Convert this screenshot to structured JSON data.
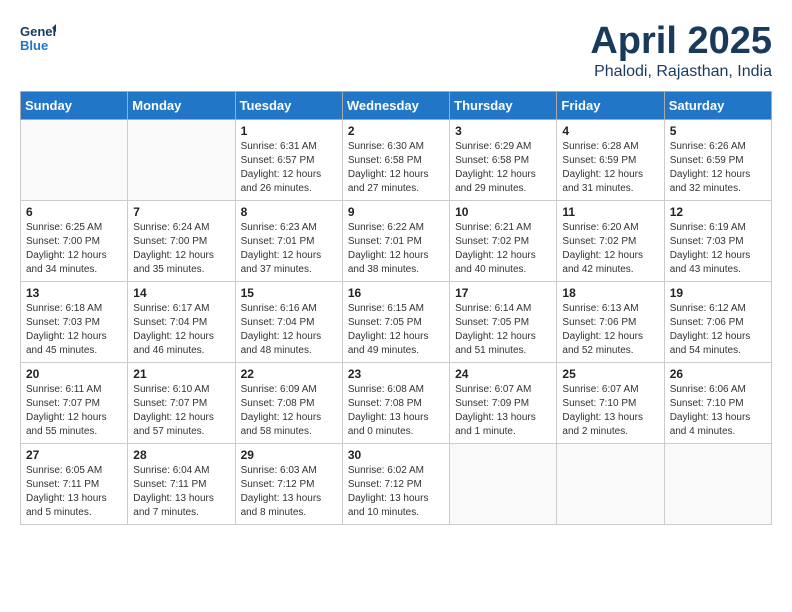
{
  "header": {
    "logo_general": "General",
    "logo_blue": "Blue",
    "month": "April 2025",
    "location": "Phalodi, Rajasthan, India"
  },
  "days_of_week": [
    "Sunday",
    "Monday",
    "Tuesday",
    "Wednesday",
    "Thursday",
    "Friday",
    "Saturday"
  ],
  "weeks": [
    [
      {
        "num": "",
        "info": ""
      },
      {
        "num": "",
        "info": ""
      },
      {
        "num": "1",
        "info": "Sunrise: 6:31 AM\nSunset: 6:57 PM\nDaylight: 12 hours\nand 26 minutes."
      },
      {
        "num": "2",
        "info": "Sunrise: 6:30 AM\nSunset: 6:58 PM\nDaylight: 12 hours\nand 27 minutes."
      },
      {
        "num": "3",
        "info": "Sunrise: 6:29 AM\nSunset: 6:58 PM\nDaylight: 12 hours\nand 29 minutes."
      },
      {
        "num": "4",
        "info": "Sunrise: 6:28 AM\nSunset: 6:59 PM\nDaylight: 12 hours\nand 31 minutes."
      },
      {
        "num": "5",
        "info": "Sunrise: 6:26 AM\nSunset: 6:59 PM\nDaylight: 12 hours\nand 32 minutes."
      }
    ],
    [
      {
        "num": "6",
        "info": "Sunrise: 6:25 AM\nSunset: 7:00 PM\nDaylight: 12 hours\nand 34 minutes."
      },
      {
        "num": "7",
        "info": "Sunrise: 6:24 AM\nSunset: 7:00 PM\nDaylight: 12 hours\nand 35 minutes."
      },
      {
        "num": "8",
        "info": "Sunrise: 6:23 AM\nSunset: 7:01 PM\nDaylight: 12 hours\nand 37 minutes."
      },
      {
        "num": "9",
        "info": "Sunrise: 6:22 AM\nSunset: 7:01 PM\nDaylight: 12 hours\nand 38 minutes."
      },
      {
        "num": "10",
        "info": "Sunrise: 6:21 AM\nSunset: 7:02 PM\nDaylight: 12 hours\nand 40 minutes."
      },
      {
        "num": "11",
        "info": "Sunrise: 6:20 AM\nSunset: 7:02 PM\nDaylight: 12 hours\nand 42 minutes."
      },
      {
        "num": "12",
        "info": "Sunrise: 6:19 AM\nSunset: 7:03 PM\nDaylight: 12 hours\nand 43 minutes."
      }
    ],
    [
      {
        "num": "13",
        "info": "Sunrise: 6:18 AM\nSunset: 7:03 PM\nDaylight: 12 hours\nand 45 minutes."
      },
      {
        "num": "14",
        "info": "Sunrise: 6:17 AM\nSunset: 7:04 PM\nDaylight: 12 hours\nand 46 minutes."
      },
      {
        "num": "15",
        "info": "Sunrise: 6:16 AM\nSunset: 7:04 PM\nDaylight: 12 hours\nand 48 minutes."
      },
      {
        "num": "16",
        "info": "Sunrise: 6:15 AM\nSunset: 7:05 PM\nDaylight: 12 hours\nand 49 minutes."
      },
      {
        "num": "17",
        "info": "Sunrise: 6:14 AM\nSunset: 7:05 PM\nDaylight: 12 hours\nand 51 minutes."
      },
      {
        "num": "18",
        "info": "Sunrise: 6:13 AM\nSunset: 7:06 PM\nDaylight: 12 hours\nand 52 minutes."
      },
      {
        "num": "19",
        "info": "Sunrise: 6:12 AM\nSunset: 7:06 PM\nDaylight: 12 hours\nand 54 minutes."
      }
    ],
    [
      {
        "num": "20",
        "info": "Sunrise: 6:11 AM\nSunset: 7:07 PM\nDaylight: 12 hours\nand 55 minutes."
      },
      {
        "num": "21",
        "info": "Sunrise: 6:10 AM\nSunset: 7:07 PM\nDaylight: 12 hours\nand 57 minutes."
      },
      {
        "num": "22",
        "info": "Sunrise: 6:09 AM\nSunset: 7:08 PM\nDaylight: 12 hours\nand 58 minutes."
      },
      {
        "num": "23",
        "info": "Sunrise: 6:08 AM\nSunset: 7:08 PM\nDaylight: 13 hours\nand 0 minutes."
      },
      {
        "num": "24",
        "info": "Sunrise: 6:07 AM\nSunset: 7:09 PM\nDaylight: 13 hours\nand 1 minute."
      },
      {
        "num": "25",
        "info": "Sunrise: 6:07 AM\nSunset: 7:10 PM\nDaylight: 13 hours\nand 2 minutes."
      },
      {
        "num": "26",
        "info": "Sunrise: 6:06 AM\nSunset: 7:10 PM\nDaylight: 13 hours\nand 4 minutes."
      }
    ],
    [
      {
        "num": "27",
        "info": "Sunrise: 6:05 AM\nSunset: 7:11 PM\nDaylight: 13 hours\nand 5 minutes."
      },
      {
        "num": "28",
        "info": "Sunrise: 6:04 AM\nSunset: 7:11 PM\nDaylight: 13 hours\nand 7 minutes."
      },
      {
        "num": "29",
        "info": "Sunrise: 6:03 AM\nSunset: 7:12 PM\nDaylight: 13 hours\nand 8 minutes."
      },
      {
        "num": "30",
        "info": "Sunrise: 6:02 AM\nSunset: 7:12 PM\nDaylight: 13 hours\nand 10 minutes."
      },
      {
        "num": "",
        "info": ""
      },
      {
        "num": "",
        "info": ""
      },
      {
        "num": "",
        "info": ""
      }
    ]
  ]
}
